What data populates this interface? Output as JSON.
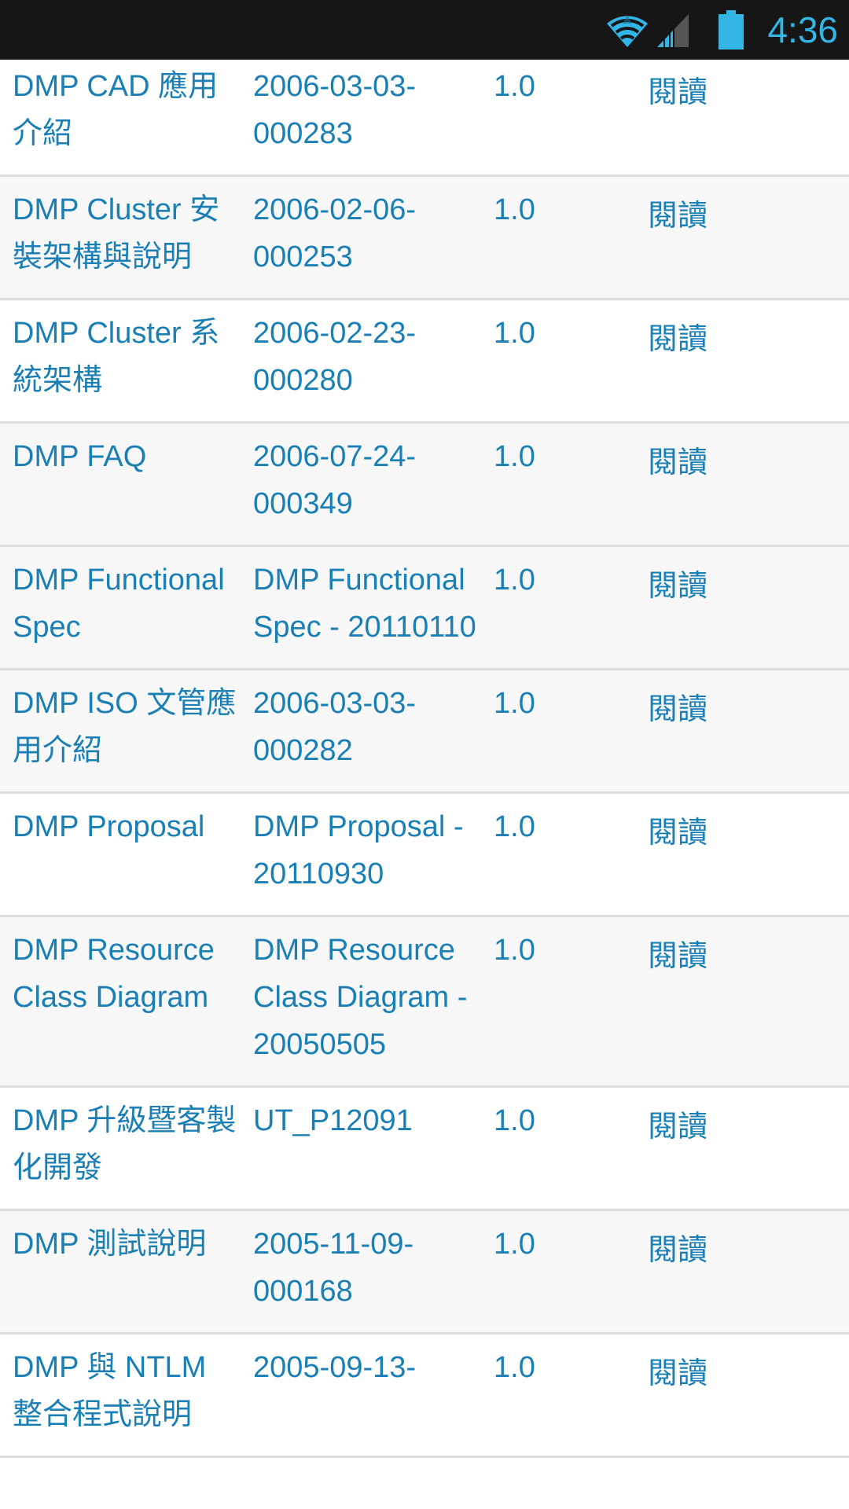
{
  "status_bar": {
    "time": "4:36",
    "icons": [
      "wifi-icon",
      "cell-signal-icon",
      "battery-icon"
    ],
    "accent_color": "#33b5e5"
  },
  "table": {
    "text_color": "#1a7fb5",
    "rows": [
      {
        "title": "DMP CAD 應用介紹",
        "doc_no": "2006-03-03-000283",
        "version": "1.0",
        "action": "閱讀",
        "shaded": false
      },
      {
        "title": "DMP Cluster 安裝架構與說明",
        "doc_no": "2006-02-06-000253",
        "version": "1.0",
        "action": "閱讀",
        "shaded": true
      },
      {
        "title": "DMP Cluster 系統架構",
        "doc_no": "2006-02-23-000280",
        "version": "1.0",
        "action": "閱讀",
        "shaded": false
      },
      {
        "title": "DMP FAQ",
        "doc_no": "2006-07-24-000349",
        "version": "1.0",
        "action": "閱讀",
        "shaded": true
      },
      {
        "title": "DMP Functional Spec",
        "doc_no": "DMP Functional Spec - 20110110",
        "version": "1.0",
        "action": "閱讀",
        "shaded": true
      },
      {
        "title": "DMP ISO 文管應用介紹",
        "doc_no": "2006-03-03-000282",
        "version": "1.0",
        "action": "閱讀",
        "shaded": true
      },
      {
        "title": "DMP Proposal",
        "doc_no": "DMP Proposal - 20110930",
        "version": "1.0",
        "action": "閱讀",
        "shaded": false
      },
      {
        "title": "DMP Resource Class Diagram",
        "doc_no": "DMP Resource Class Diagram - 20050505",
        "version": "1.0",
        "action": "閱讀",
        "shaded": true
      },
      {
        "title": "DMP 升級暨客製化開發",
        "doc_no": "UT_P12091",
        "version": "1.0",
        "action": "閱讀",
        "shaded": false
      },
      {
        "title": "DMP 測試說明",
        "doc_no": "2005-11-09-000168",
        "version": "1.0",
        "action": "閱讀",
        "shaded": true
      },
      {
        "title": "DMP 與 NTLM 整合程式說明",
        "doc_no": "2005-09-13-",
        "version": "1.0",
        "action": "閱讀",
        "shaded": false
      }
    ]
  }
}
